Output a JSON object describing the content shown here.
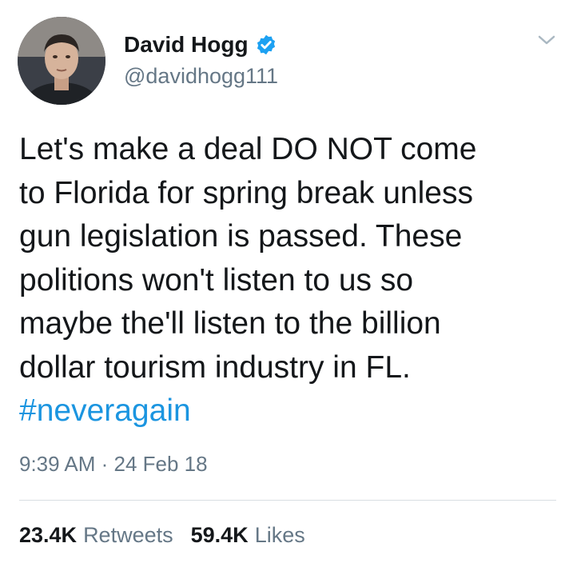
{
  "author": {
    "display_name": "David Hogg",
    "handle": "@davidhogg111",
    "verified": true,
    "avatar_icon": "profile-photo"
  },
  "menu": {
    "icon": "chevron-down-icon"
  },
  "tweet": {
    "lines": [
      "Let's make a deal DO NOT come",
      "to Florida for spring break unless",
      "gun legislation is passed. These",
      "politions won't listen to us so",
      "maybe the'll listen to the billion",
      "dollar tourism industry in FL."
    ],
    "hashtag": "#neveragain"
  },
  "meta": {
    "timestamp": "9:39 AM · 24 Feb 18"
  },
  "stats": {
    "retweets_count": "23.4K",
    "retweets_label": "Retweets",
    "likes_count": "59.4K",
    "likes_label": "Likes"
  },
  "colors": {
    "link": "#1b95e0",
    "secondary_text": "#657786",
    "primary_text": "#14171a",
    "verified_badge": "#1da1f2",
    "divider": "#d8dee3"
  }
}
